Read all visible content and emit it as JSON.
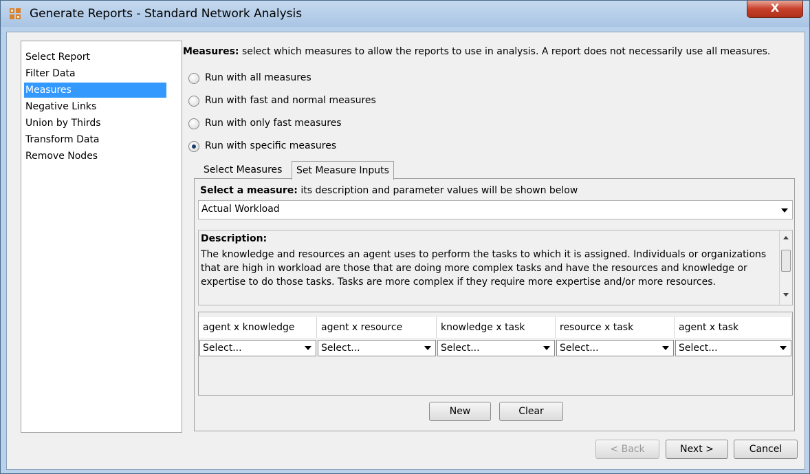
{
  "window": {
    "title": "Generate Reports - Standard Network Analysis",
    "close_label": "X"
  },
  "sidebar": {
    "items": [
      {
        "label": "Select Report",
        "selected": false
      },
      {
        "label": "Filter Data",
        "selected": false
      },
      {
        "label": "Measures",
        "selected": true
      },
      {
        "label": "Negative Links",
        "selected": false
      },
      {
        "label": "Union by Thirds",
        "selected": false
      },
      {
        "label": "Transform Data",
        "selected": false
      },
      {
        "label": "Remove Nodes",
        "selected": false
      }
    ]
  },
  "main": {
    "heading_bold": "Measures:",
    "heading_rest": " select which measures to allow the reports to use in analysis. A report does not necessarily use all measures.",
    "radios": [
      {
        "label": "Run with all measures",
        "checked": false
      },
      {
        "label": "Run with fast and normal measures",
        "checked": false
      },
      {
        "label": "Run with only fast measures",
        "checked": false
      },
      {
        "label": "Run with specific measures",
        "checked": true
      }
    ],
    "tabs": [
      {
        "label": "Select Measures",
        "active": false
      },
      {
        "label": "Set Measure Inputs",
        "active": true
      }
    ],
    "select_heading_bold": "Select a measure:",
    "select_heading_rest": " its description and parameter values will be shown below",
    "measure_value": "Actual Workload",
    "description_title": "Description:",
    "description_text": "The knowledge and resources an agent uses to perform the tasks to which it is assigned. Individuals or organizations that are high in workload are those that are doing more complex tasks and have the resources and knowledge or expertise to do those tasks. Tasks are more complex if they require more expertise and/or more resources.",
    "columns": [
      {
        "header": "agent x knowledge",
        "value": "Select..."
      },
      {
        "header": "agent x resource",
        "value": "Select..."
      },
      {
        "header": "knowledge x task",
        "value": "Select..."
      },
      {
        "header": "resource x task",
        "value": "Select..."
      },
      {
        "header": "agent x task",
        "value": "Select..."
      }
    ],
    "new_label": "New",
    "clear_label": "Clear"
  },
  "footer": {
    "back_label": "< Back",
    "next_label": "Next >",
    "cancel_label": "Cancel"
  },
  "colors": {
    "selection": "#3399ff",
    "title_bar": "#b9d1ea",
    "close": "#c7402b"
  }
}
